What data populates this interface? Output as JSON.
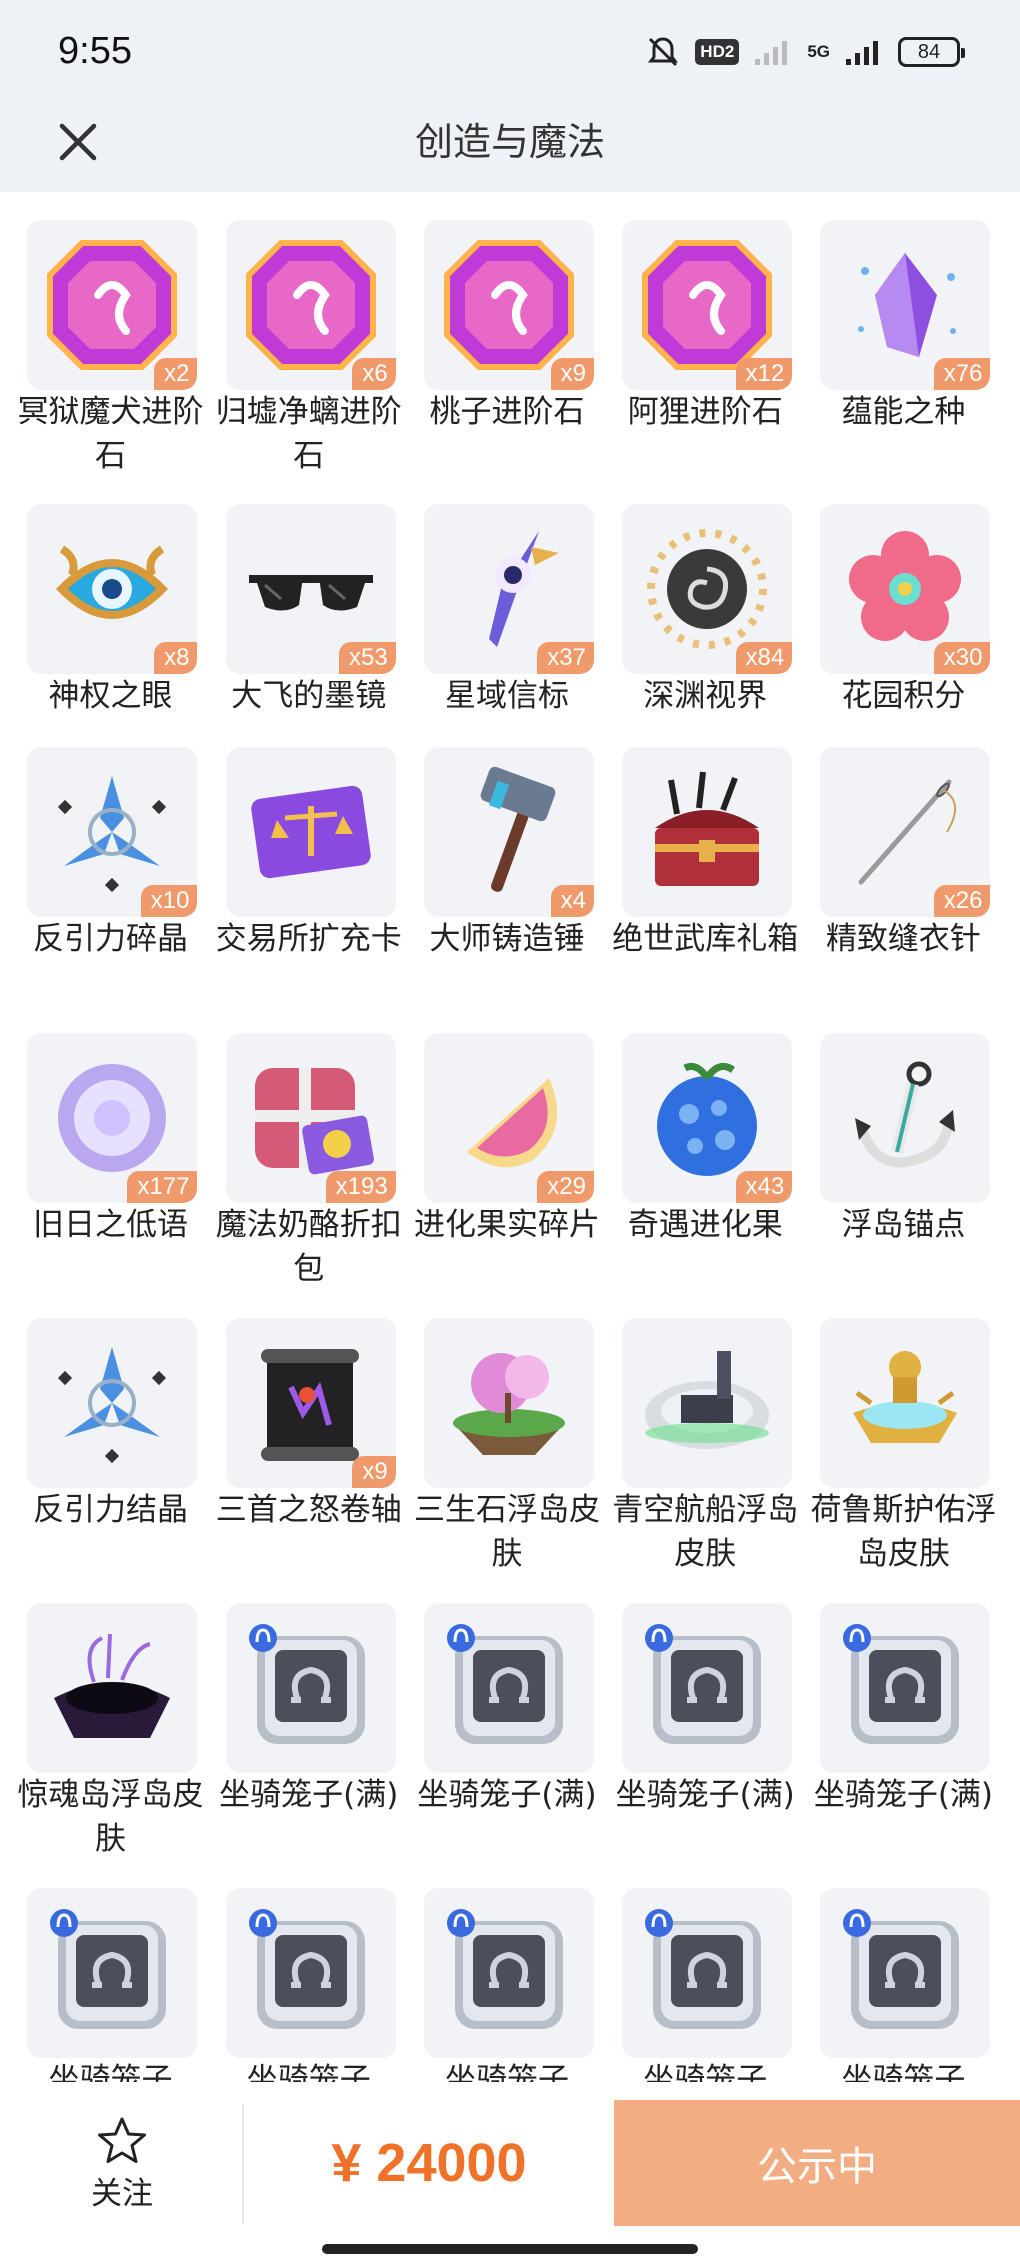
{
  "status_bar": {
    "time": "9:55",
    "hd": "HD2",
    "network": "5G",
    "battery": "84"
  },
  "header": {
    "title": "创造与魔法"
  },
  "items": [
    {
      "name": "冥狱魔犬进阶石",
      "qty": "x2",
      "icon": "gem-icon",
      "color": "#c03ad8"
    },
    {
      "name": "归墟净螭进阶石",
      "qty": "x6",
      "icon": "gem-icon",
      "color": "#c03ad8"
    },
    {
      "name": "桃子进阶石",
      "qty": "x9",
      "icon": "gem-icon",
      "color": "#c03ad8"
    },
    {
      "name": "阿狸进阶石",
      "qty": "x12",
      "icon": "gem-icon",
      "color": "#c03ad8"
    },
    {
      "name": "蕴能之种",
      "qty": "x76",
      "icon": "crystal-icon",
      "color": "#8e4fe0"
    },
    {
      "name": "神权之眼",
      "qty": "x8",
      "icon": "eye-icon",
      "color": "#2aa9e0"
    },
    {
      "name": "大飞的墨镜",
      "qty": "x53",
      "icon": "sunglasses-icon",
      "color": "#222222"
    },
    {
      "name": "星域信标",
      "qty": "x37",
      "icon": "beacon-icon",
      "color": "#6a5fd8"
    },
    {
      "name": "深渊视界",
      "qty": "x84",
      "icon": "vortex-icon",
      "color": "#3a3a3a"
    },
    {
      "name": "花园积分",
      "qty": "x30",
      "icon": "flower-icon",
      "color": "#f06a8a"
    },
    {
      "name": "反引力碎晶",
      "qty": "x10",
      "icon": "antigravity-icon",
      "color": "#4a90e0"
    },
    {
      "name": "交易所扩充卡",
      "qty": "",
      "icon": "card-icon",
      "color": "#8a4ae0"
    },
    {
      "name": "大师铸造锤",
      "qty": "x4",
      "icon": "hammer-icon",
      "color": "#6a7a90"
    },
    {
      "name": "绝世武库礼箱",
      "qty": "",
      "icon": "chest-icon",
      "color": "#b0303a"
    },
    {
      "name": "精致缝衣针",
      "qty": "x26",
      "icon": "needle-icon",
      "color": "#9a9a9a"
    },
    {
      "name": "旧日之低语",
      "qty": "x177",
      "icon": "orb-icon",
      "color": "#b9a8f0"
    },
    {
      "name": "魔法奶酪折扣包",
      "qty": "x193",
      "icon": "giftbox-icon",
      "color": "#d45a78"
    },
    {
      "name": "进化果实碎片",
      "qty": "x29",
      "icon": "fruit-slice-icon",
      "color": "#e96aa0"
    },
    {
      "name": "奇遇进化果",
      "qty": "x43",
      "icon": "berry-icon",
      "color": "#2f6fe0"
    },
    {
      "name": "浮岛锚点",
      "qty": "",
      "icon": "anchor-icon",
      "color": "#3aa9a0"
    },
    {
      "name": "反引力结晶",
      "qty": "",
      "icon": "antigravity-icon",
      "color": "#4a90e0"
    },
    {
      "name": "三首之怒卷轴",
      "qty": "x9",
      "icon": "scroll-icon",
      "color": "#222222"
    },
    {
      "name": "三生石浮岛皮肤",
      "qty": "",
      "icon": "island-icon",
      "color": "#e08ad8"
    },
    {
      "name": "青空航船浮岛皮肤",
      "qty": "",
      "icon": "arena-island-icon",
      "color": "#3a3f4a"
    },
    {
      "name": "荷鲁斯护佑浮岛皮肤",
      "qty": "",
      "icon": "golden-island-icon",
      "color": "#e0b040"
    },
    {
      "name": "惊魂岛浮岛皮肤",
      "qty": "",
      "icon": "dark-island-icon",
      "color": "#2a1a3a"
    },
    {
      "name": "坐骑笼子(满)",
      "qty": "",
      "icon": "mount-cage-icon",
      "color": "#4a4f5a"
    },
    {
      "name": "坐骑笼子(满)",
      "qty": "",
      "icon": "mount-cage-icon",
      "color": "#4a4f5a"
    },
    {
      "name": "坐骑笼子(满)",
      "qty": "",
      "icon": "mount-cage-icon",
      "color": "#4a4f5a"
    },
    {
      "name": "坐骑笼子(满)",
      "qty": "",
      "icon": "mount-cage-icon",
      "color": "#4a4f5a"
    },
    {
      "name": "坐骑笼子",
      "qty": "",
      "icon": "mount-cage-icon",
      "color": "#4a4f5a"
    },
    {
      "name": "坐骑笼子",
      "qty": "",
      "icon": "mount-cage-icon",
      "color": "#4a4f5a"
    },
    {
      "name": "坐骑笼子",
      "qty": "",
      "icon": "mount-cage-icon",
      "color": "#4a4f5a"
    },
    {
      "name": "坐骑笼子",
      "qty": "",
      "icon": "mount-cage-icon",
      "color": "#4a4f5a"
    },
    {
      "name": "坐骑笼子",
      "qty": "",
      "icon": "mount-cage-icon",
      "color": "#4a4f5a"
    }
  ],
  "footer": {
    "follow_label": "关注",
    "price": "¥ 24000",
    "action_label": "公示中",
    "accent": "#f07228",
    "action_color": "#f3ad83"
  }
}
